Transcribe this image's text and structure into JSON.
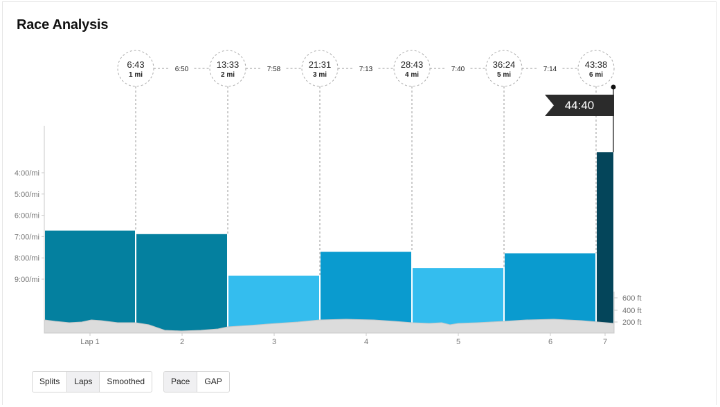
{
  "title": "Race Analysis",
  "finish_time": "44:40",
  "colors": {
    "lap_fast": "#04809f",
    "lap_mid": "#0a9bcf",
    "lap_slow": "#34bdee",
    "lap_last": "#04455a",
    "elevation": "#dcdcdc"
  },
  "chart_data": {
    "type": "bar",
    "categories": [
      "Lap 1",
      "2",
      "3",
      "4",
      "5",
      "6",
      "7"
    ],
    "pace_ticks": [
      "4:00/mi",
      "5:00/mi",
      "6:00/mi",
      "7:00/mi",
      "8:00/mi",
      "9:00/mi"
    ],
    "elevation_ticks": [
      "600 ft",
      "400 ft",
      "200 ft"
    ],
    "series": [
      {
        "values_sec_per_mi": [
          403,
          413,
          530,
          463,
          509,
          467,
          182
        ]
      }
    ],
    "milestones": [
      {
        "time": "6:43",
        "label": "1 mi"
      },
      {
        "time": "13:33",
        "label": "2 mi"
      },
      {
        "time": "21:31",
        "label": "3 mi"
      },
      {
        "time": "28:43",
        "label": "4 mi"
      },
      {
        "time": "36:24",
        "label": "5 mi"
      },
      {
        "time": "43:38",
        "label": "6 mi"
      }
    ],
    "splits": [
      "6:50",
      "7:58",
      "7:13",
      "7:40",
      "7:14"
    ]
  },
  "controls": {
    "view_buttons": [
      {
        "label": "Splits",
        "active": false
      },
      {
        "label": "Laps",
        "active": true
      },
      {
        "label": "Smoothed",
        "active": false
      }
    ],
    "metric_buttons": [
      {
        "label": "Pace",
        "active": true
      },
      {
        "label": "GAP",
        "active": false
      }
    ]
  }
}
